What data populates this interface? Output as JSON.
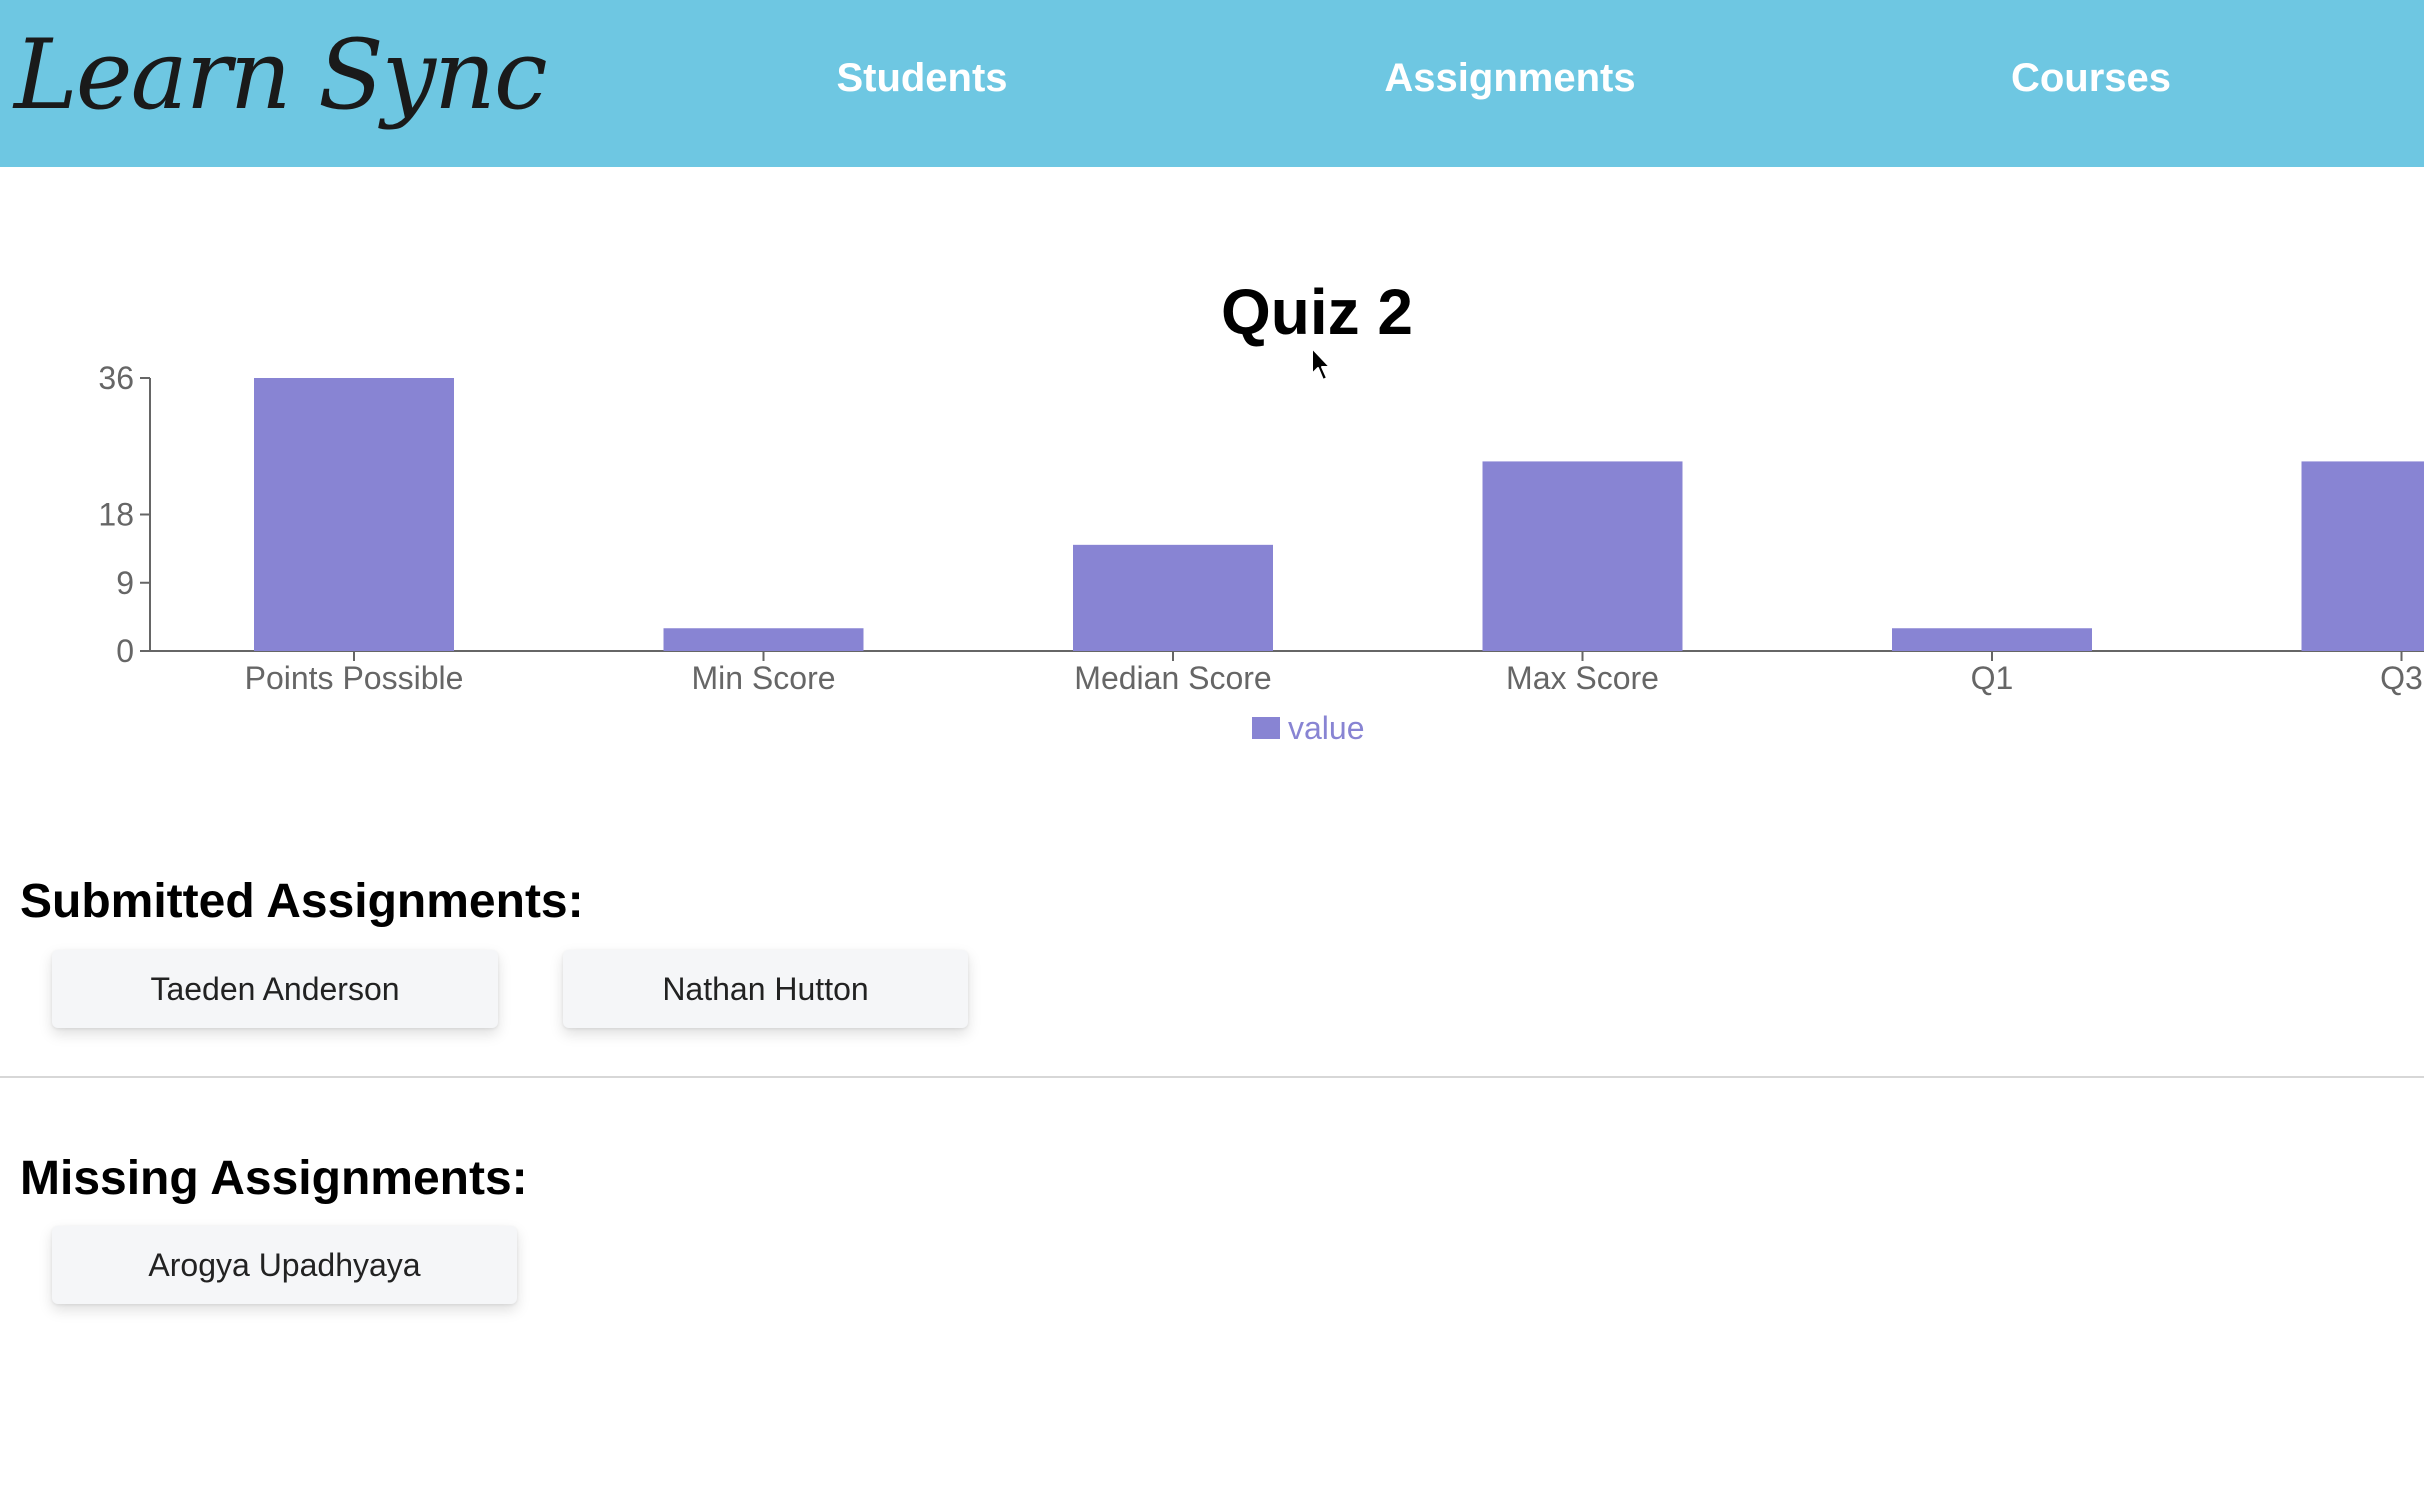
{
  "app": {
    "logo_text": "Learn Sync"
  },
  "nav": {
    "items": [
      "Students",
      "Assignments",
      "Courses"
    ]
  },
  "chart_data": {
    "type": "bar",
    "title": "Quiz 2",
    "categories": [
      "Points Possible",
      "Min Score",
      "Median Score",
      "Max Score",
      "Q1",
      "Q3"
    ],
    "series": [
      {
        "name": "value",
        "values": [
          36,
          3,
          14,
          25,
          3,
          25
        ],
        "color": "#8884d3"
      }
    ],
    "ylim": [
      0,
      36
    ],
    "yticks": [
      0,
      9,
      18,
      36
    ],
    "xlabel": "",
    "ylabel": "",
    "grid": false,
    "legend": "bottom-center"
  },
  "submitted": {
    "heading": "Submitted Assignments:",
    "students": [
      "Taeden Anderson",
      "Nathan Hutton"
    ]
  },
  "missing": {
    "heading": "Missing Assignments:",
    "students": [
      "Arogya Upadhyaya"
    ]
  }
}
